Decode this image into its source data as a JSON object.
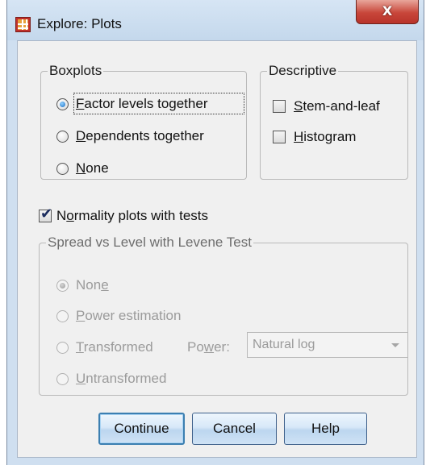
{
  "window": {
    "title": "Explore: Plots",
    "close_glyph": "X"
  },
  "boxplots": {
    "legend": "Boxplots",
    "options": [
      {
        "pre": "",
        "key": "F",
        "post": "actor levels together",
        "selected": true
      },
      {
        "pre": "",
        "key": "D",
        "post": "ependents together",
        "selected": false
      },
      {
        "pre": "",
        "key": "N",
        "post": "one",
        "selected": false
      }
    ]
  },
  "descriptive": {
    "legend": "Descriptive",
    "options": [
      {
        "pre": "",
        "key": "S",
        "post": "tem-and-leaf",
        "checked": false
      },
      {
        "pre": "",
        "key": "H",
        "post": "istogram",
        "checked": false
      }
    ]
  },
  "normality": {
    "pre": "N",
    "key": "o",
    "post": "rmality plots with tests",
    "checked": true
  },
  "spread": {
    "legend": "Spread vs Level with Levene Test",
    "options": [
      {
        "pre": "Non",
        "key": "e",
        "post": "",
        "selected": true
      },
      {
        "pre": "",
        "key": "P",
        "post": "ower estimation",
        "selected": false
      },
      {
        "pre": "",
        "key": "T",
        "post": "ransformed",
        "selected": false
      },
      {
        "pre": "",
        "key": "U",
        "post": "ntransformed",
        "selected": false
      }
    ],
    "power": {
      "pre": "Po",
      "key": "w",
      "post": "er:"
    },
    "power_select_value": "Natural log"
  },
  "buttons": {
    "continue": "Continue",
    "cancel": "Cancel",
    "help": "Help"
  },
  "icons": {
    "app": "spss-table-icon",
    "close": "close-icon",
    "dropdown": "chevron-down-icon"
  }
}
